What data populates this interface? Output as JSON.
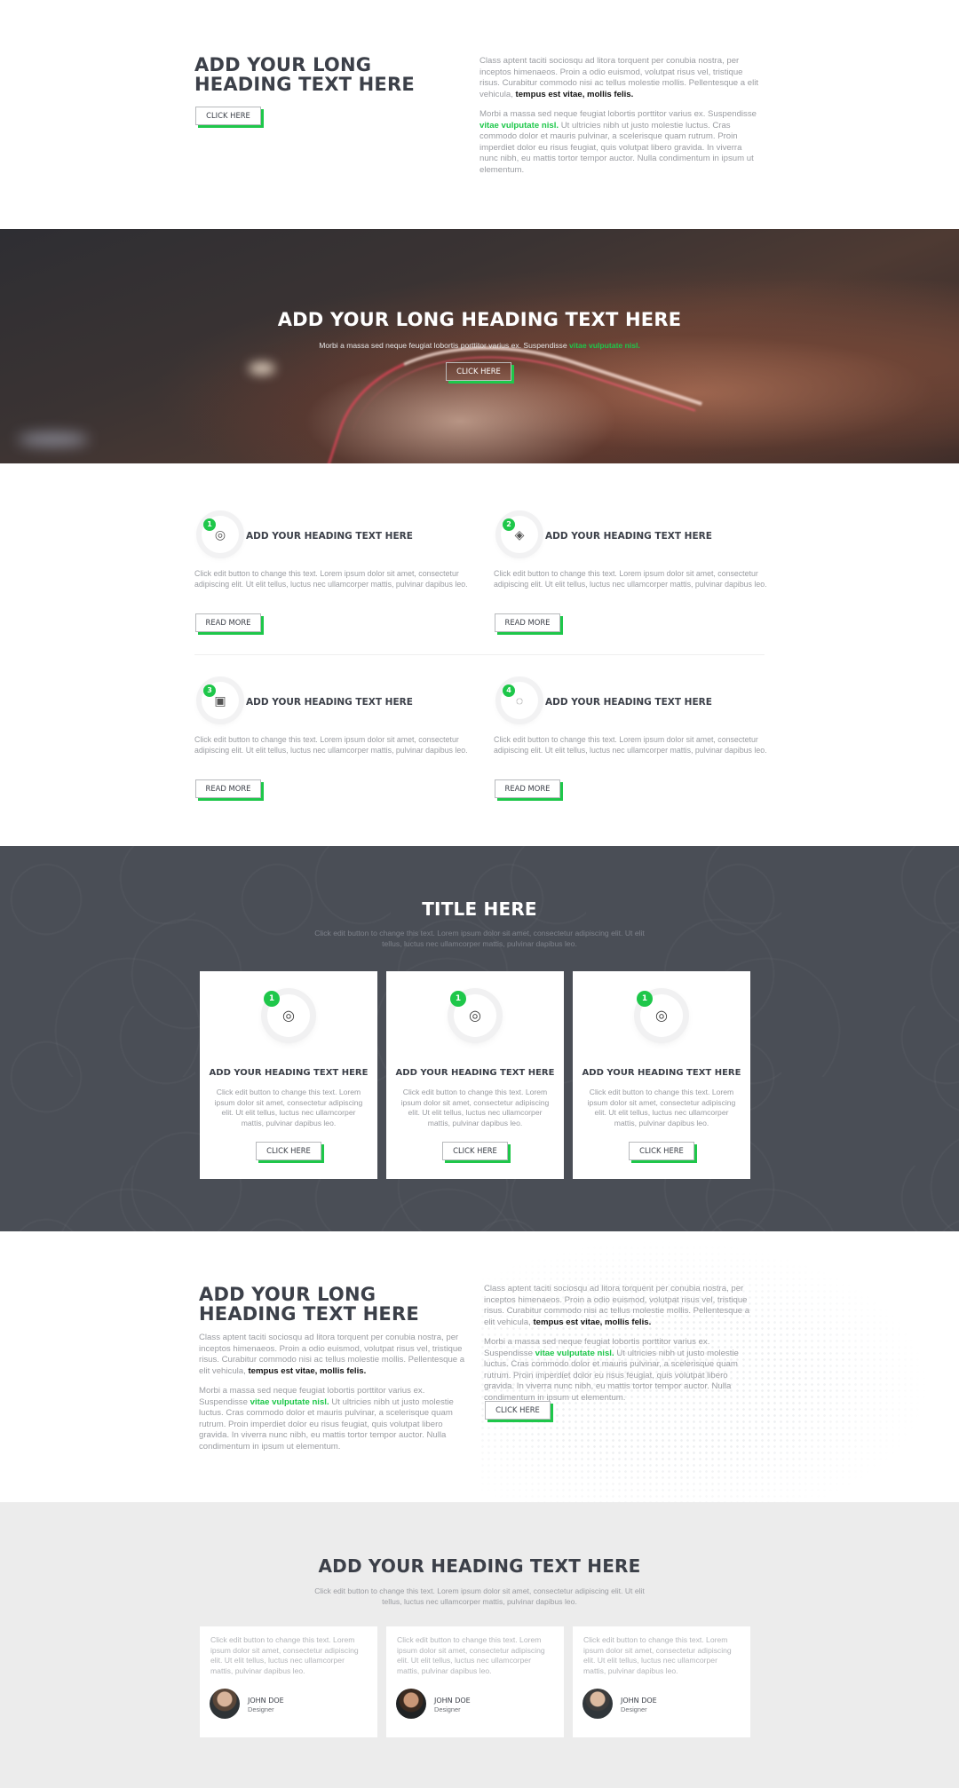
{
  "intro": {
    "heading": "ADD YOUR LONG HEADING TEXT HERE",
    "button": "CLICK HERE",
    "para1_a": "Class aptent taciti sociosqu ad litora torquent per conubia nostra, per inceptos himenaeos. Proin a odio euismod, volutpat risus vel, tristique risus. Curabitur commodo nisi ac tellus molestie mollis. Pellentesque a elit vehicula, ",
    "para1_b": "tempus est vitae, mollis felis.",
    "para2_a": "Morbi a massa sed neque feugiat lobortis porttitor varius ex. Suspendisse ",
    "para2_b": "vitae vulputate nisl.",
    "para2_c": " Ut ultricies nibh ut justo molestie luctus. Cras commodo dolor et mauris pulvinar, a scelerisque quam rutrum. Proin imperdiet dolor eu risus feugiat, quis volutpat libero gravida. In viverra nunc nibh, eu mattis tortor tempor auctor. Nulla condimentum in ipsum ut elementum."
  },
  "hero": {
    "heading": "ADD YOUR LONG HEADING TEXT HERE",
    "text_a": "Morbi a massa sed neque feugiat lobortis porttitor varius ex. Suspendisse ",
    "text_b": "vitae vulputate nisl.",
    "button": "CLICK HERE"
  },
  "features": [
    {
      "num": "1",
      "icon": "fingerprint-icon",
      "title": "ADD YOUR HEADING TEXT HERE",
      "text": "Click edit button to change this text. Lorem ipsum dolor sit amet, consectetur adipiscing elit. Ut elit tellus, luctus nec ullamcorper mattis, pulvinar dapibus leo.",
      "button": "READ MORE"
    },
    {
      "num": "2",
      "icon": "layers-icon",
      "title": "ADD YOUR HEADING TEXT HERE",
      "text": "Click edit button to change this text. Lorem ipsum dolor sit amet, consectetur adipiscing elit. Ut elit tellus, luctus nec ullamcorper mattis, pulvinar dapibus leo.",
      "button": "READ MORE"
    },
    {
      "num": "3",
      "icon": "image-icon",
      "title": "ADD YOUR HEADING TEXT HERE",
      "text": "Click edit button to change this text. Lorem ipsum dolor sit amet, consectetur adipiscing elit. Ut elit tellus, luctus nec ullamcorper mattis, pulvinar dapibus leo.",
      "button": "READ MORE"
    },
    {
      "num": "4",
      "icon": "chat-icon",
      "title": "ADD YOUR HEADING TEXT HERE",
      "text": "Click edit button to change this text. Lorem ipsum dolor sit amet, consectetur adipiscing elit. Ut elit tellus, luctus nec ullamcorper mattis, pulvinar dapibus leo.",
      "button": "READ MORE"
    }
  ],
  "dark": {
    "title": "TITLE HERE",
    "subtitle": "Click edit button to change this text. Lorem ipsum dolor sit amet, consectetur adipiscing elit. Ut elit tellus, luctus nec ullamcorper mattis, pulvinar dapibus leo.",
    "cards": [
      {
        "num": "1",
        "icon": "fingerprint-icon",
        "title": "ADD YOUR HEADING TEXT HERE",
        "text": "Click edit button to change this text. Lorem ipsum dolor sit amet, consectetur adipiscing elit. Ut elit tellus, luctus nec ullamcorper mattis, pulvinar dapibus leo.",
        "button": "CLICK HERE"
      },
      {
        "num": "1",
        "icon": "fingerprint-icon",
        "title": "ADD YOUR HEADING TEXT HERE",
        "text": "Click edit button to change this text. Lorem ipsum dolor sit amet, consectetur adipiscing elit. Ut elit tellus, luctus nec ullamcorper mattis, pulvinar dapibus leo.",
        "button": "CLICK HERE"
      },
      {
        "num": "1",
        "icon": "fingerprint-icon",
        "title": "ADD YOUR HEADING TEXT HERE",
        "text": "Click edit button to change this text. Lorem ipsum dolor sit amet, consectetur adipiscing elit. Ut elit tellus, luctus nec ullamcorper mattis, pulvinar dapibus leo.",
        "button": "CLICK HERE"
      }
    ]
  },
  "map_section": {
    "heading": "ADD YOUR LONG HEADING TEXT HERE",
    "left_p1_a": "Class aptent taciti sociosqu ad litora torquent per conubia nostra, per inceptos himenaeos. Proin a odio euismod, volutpat risus vel, tristique risus. Curabitur commodo nisi ac tellus molestie mollis. Pellentesque a elit vehicula, ",
    "left_p1_b": "tempus est vitae, mollis felis.",
    "left_p2_a": "Morbi a massa sed neque feugiat lobortis porttitor varius ex. Suspendisse ",
    "left_p2_b": "vitae vulputate nisl.",
    "left_p2_c": " Ut ultricies nibh ut justo molestie luctus. Cras commodo dolor et mauris pulvinar, a scelerisque quam rutrum. Proin imperdiet dolor eu risus feugiat, quis volutpat libero gravida. In viverra nunc nibh, eu mattis tortor tempor auctor. Nulla condimentum in ipsum ut elementum.",
    "right_p1_a": "Class aptent taciti sociosqu ad litora torquent per conubia nostra, per inceptos himenaeos. Proin a odio euismod, volutpat risus vel, tristique risus. Curabitur commodo nisi ac tellus molestie mollis. Pellentesque a elit vehicula, ",
    "right_p1_b": "tempus est vitae, mollis felis.",
    "right_p2_a": "Morbi a massa sed neque feugiat lobortis porttitor varius ex. Suspendisse ",
    "right_p2_b": "vitae vulputate nisl.",
    "right_p2_c": " Ut ultricies nibh ut justo molestie luctus. Cras commodo dolor et mauris pulvinar, a scelerisque quam rutrum. Proin imperdiet dolor eu risus feugiat, quis volutpat libero gravida. In viverra nunc nibh, eu mattis tortor tempor auctor. Nulla condimentum in ipsum ut elementum.",
    "button": "CLICK HERE"
  },
  "testimonials": {
    "heading": "ADD YOUR HEADING TEXT HERE",
    "subtitle": "Click edit button to change this text. Lorem ipsum dolor sit amet, consectetur adipiscing elit. Ut elit tellus, luctus nec ullamcorper mattis, pulvinar dapibus leo.",
    "items": [
      {
        "text": "Click edit button to change this text. Lorem ipsum dolor sit amet, consectetur adipiscing elit. Ut elit tellus, luctus nec ullamcorper mattis, pulvinar dapibus leo.",
        "name": "JOHN DOE",
        "role": "Designer"
      },
      {
        "text": "Click edit button to change this text. Lorem ipsum dolor sit amet, consectetur adipiscing elit. Ut elit tellus, luctus nec ullamcorper mattis, pulvinar dapibus leo.",
        "name": "JOHN DOE",
        "role": "Designer"
      },
      {
        "text": "Click edit button to change this text. Lorem ipsum dolor sit amet, consectetur adipiscing elit. Ut elit tellus, luctus nec ullamcorper mattis, pulvinar dapibus leo.",
        "name": "JOHN DOE",
        "role": "Designer"
      }
    ]
  },
  "colors": {
    "accent": "#1ec74a",
    "dark_bg": "#4a4e56",
    "heading": "#3c4049",
    "light_bg": "#ececec"
  }
}
